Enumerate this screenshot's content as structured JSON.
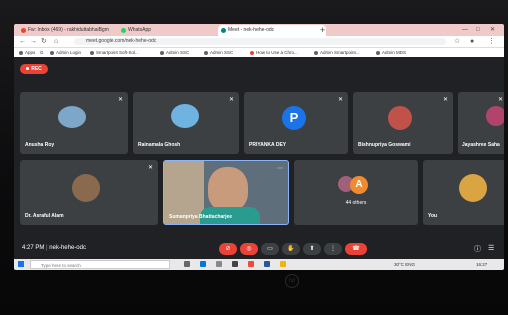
{
  "browser": {
    "tabs": [
      {
        "label": "Fw: Inbox (469) - rakhiduttabhaiBgm",
        "icon_color": "#ea4335"
      },
      {
        "label": "WhatsApp",
        "icon_color": "#25d366"
      },
      {
        "label": "Meet - nek-hehe-odc",
        "icon_color": "#00897b"
      }
    ],
    "new_tab": "+",
    "url": "meet.google.com/nek-hehe-odc",
    "bookmarks": [
      "Apps",
      "G",
      "Admin Login",
      "Smartpoint Soft-Sol...",
      "Admin SSC",
      "Admin SSC",
      "How to Use a Chro...",
      "Admin Smartpoint...",
      "Admin MDS"
    ]
  },
  "meet": {
    "rec_label": "REC",
    "participants": [
      {
        "name": "Anusha Roy",
        "avatar_color": "#7ea6c9"
      },
      {
        "name": "Rainamala Ghosh",
        "avatar_color": "#6fb3e0"
      },
      {
        "name": "PRIYANKA DEY",
        "letter": "P",
        "avatar_color": "#1a73e8"
      },
      {
        "name": "Bishnupriya Goswami",
        "avatar_color": "#c0524a"
      },
      {
        "name": "Jayashree Saha",
        "avatar_color": "#b0446a"
      },
      {
        "name": "Dr. Asraful Alam",
        "avatar_color": "#8a6a4f"
      },
      {
        "name": "Sumanpriya Bhattacharjee"
      },
      {
        "name": "You",
        "avatar_color": "#d9a441"
      }
    ],
    "others": {
      "label": "44 others",
      "letter": "A",
      "letter_color": "#f28b30"
    },
    "time": "4:27 PM",
    "meeting_code": "nek-hehe-odc"
  },
  "taskbar": {
    "search_placeholder": "Type here to search",
    "tray_text": "30°C  ENG",
    "clock": "16:27"
  },
  "hp_logo": "hp"
}
